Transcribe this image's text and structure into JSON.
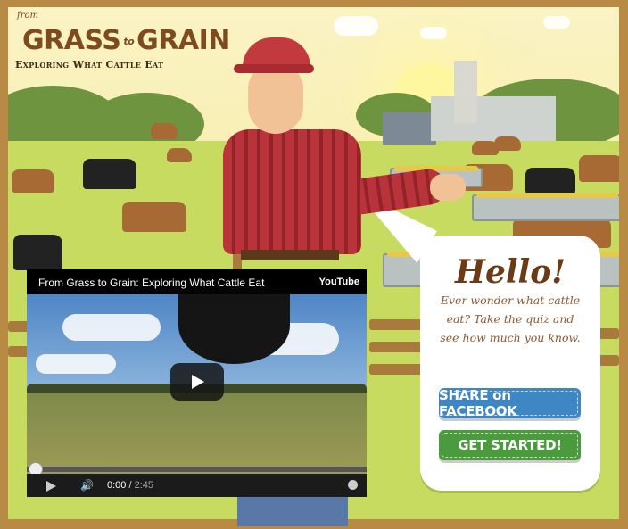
{
  "logo": {
    "from": "from",
    "part1": "GRASS",
    "connector": "to",
    "part2": "GRAIN",
    "tagline": "Exploring What Cattle Eat"
  },
  "bubble": {
    "greeting": "Hello!",
    "blurb": "Ever wonder what cattle eat? Take the quiz and see how much you know.",
    "share_button": "SHARE on FACEBOOK",
    "start_button": "GET STARTED!"
  },
  "video": {
    "title": "From Grass to Grain: Exploring What Cattle Eat",
    "brand": "YouTube",
    "current_time": "0:00",
    "separator": " / ",
    "duration": "2:45",
    "progress": 0
  },
  "colors": {
    "frame": "#b88a43",
    "brand_brown": "#7d4b1d",
    "facebook_blue": "#3f86c4",
    "start_green": "#4c9a3e"
  }
}
